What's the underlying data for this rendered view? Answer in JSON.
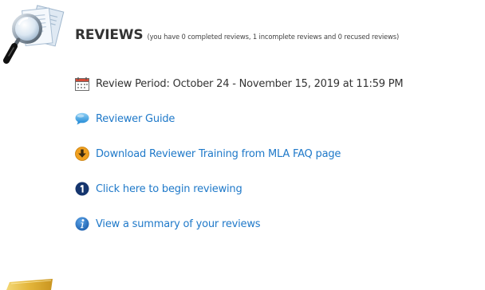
{
  "reviews": {
    "title": "REVIEWS",
    "summary_note": "(you have 0 completed reviews, 1 incomplete reviews and 0 recused reviews)"
  },
  "items": [
    {
      "label": "Review Period: October 24 - November 15, 2019 at 11:59 PM",
      "icon": "calendar-icon"
    },
    {
      "label": "Reviewer Guide",
      "icon": "speech-bubble-icon"
    },
    {
      "label": "Download Reviewer Training from MLA FAQ page",
      "icon": "download-arrow-icon"
    },
    {
      "label": "Click here to begin reviewing",
      "icon": "number-one-icon"
    },
    {
      "label": "View a summary of your reviews",
      "icon": "info-icon"
    }
  ],
  "colors": {
    "link": "#1f79c9",
    "text": "#333333",
    "accent_orange": "#f0a020",
    "info_blue": "#1c5fae",
    "number_navy": "#15356e"
  }
}
